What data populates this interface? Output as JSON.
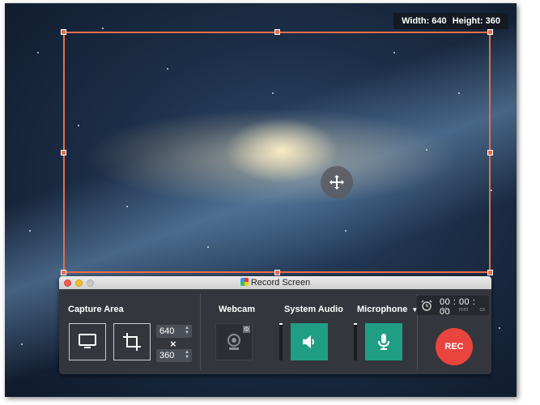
{
  "overlay": {
    "width_label": "Width: 640",
    "height_label": "Height: 360"
  },
  "window": {
    "title": "Record Screen"
  },
  "capture_area": {
    "label": "Capture Area",
    "width": "640",
    "times": "×",
    "height": "360"
  },
  "webcam": {
    "label": "Webcam"
  },
  "system_audio": {
    "label": "System Audio",
    "level": 0.05
  },
  "microphone": {
    "label": "Microphone",
    "dropdown_arrow": "▼",
    "level": 0.05
  },
  "timer": {
    "hh": "00",
    "mm": "00",
    "ss": "00",
    "sep": ":",
    "hh_label": "hh",
    "mm_label": "mm",
    "ss_label": "ss"
  },
  "rec_button": {
    "label": "REC"
  },
  "icons": [
    "monitor-icon",
    "crop-icon",
    "webcam-icon",
    "gear-icon",
    "speaker-icon",
    "microphone-icon",
    "alarm-clock-icon",
    "move-icon"
  ],
  "colors": {
    "accent": "#e96e49",
    "green": "#1f9e84",
    "rec": "#e9443d",
    "panel": "#33373d"
  }
}
